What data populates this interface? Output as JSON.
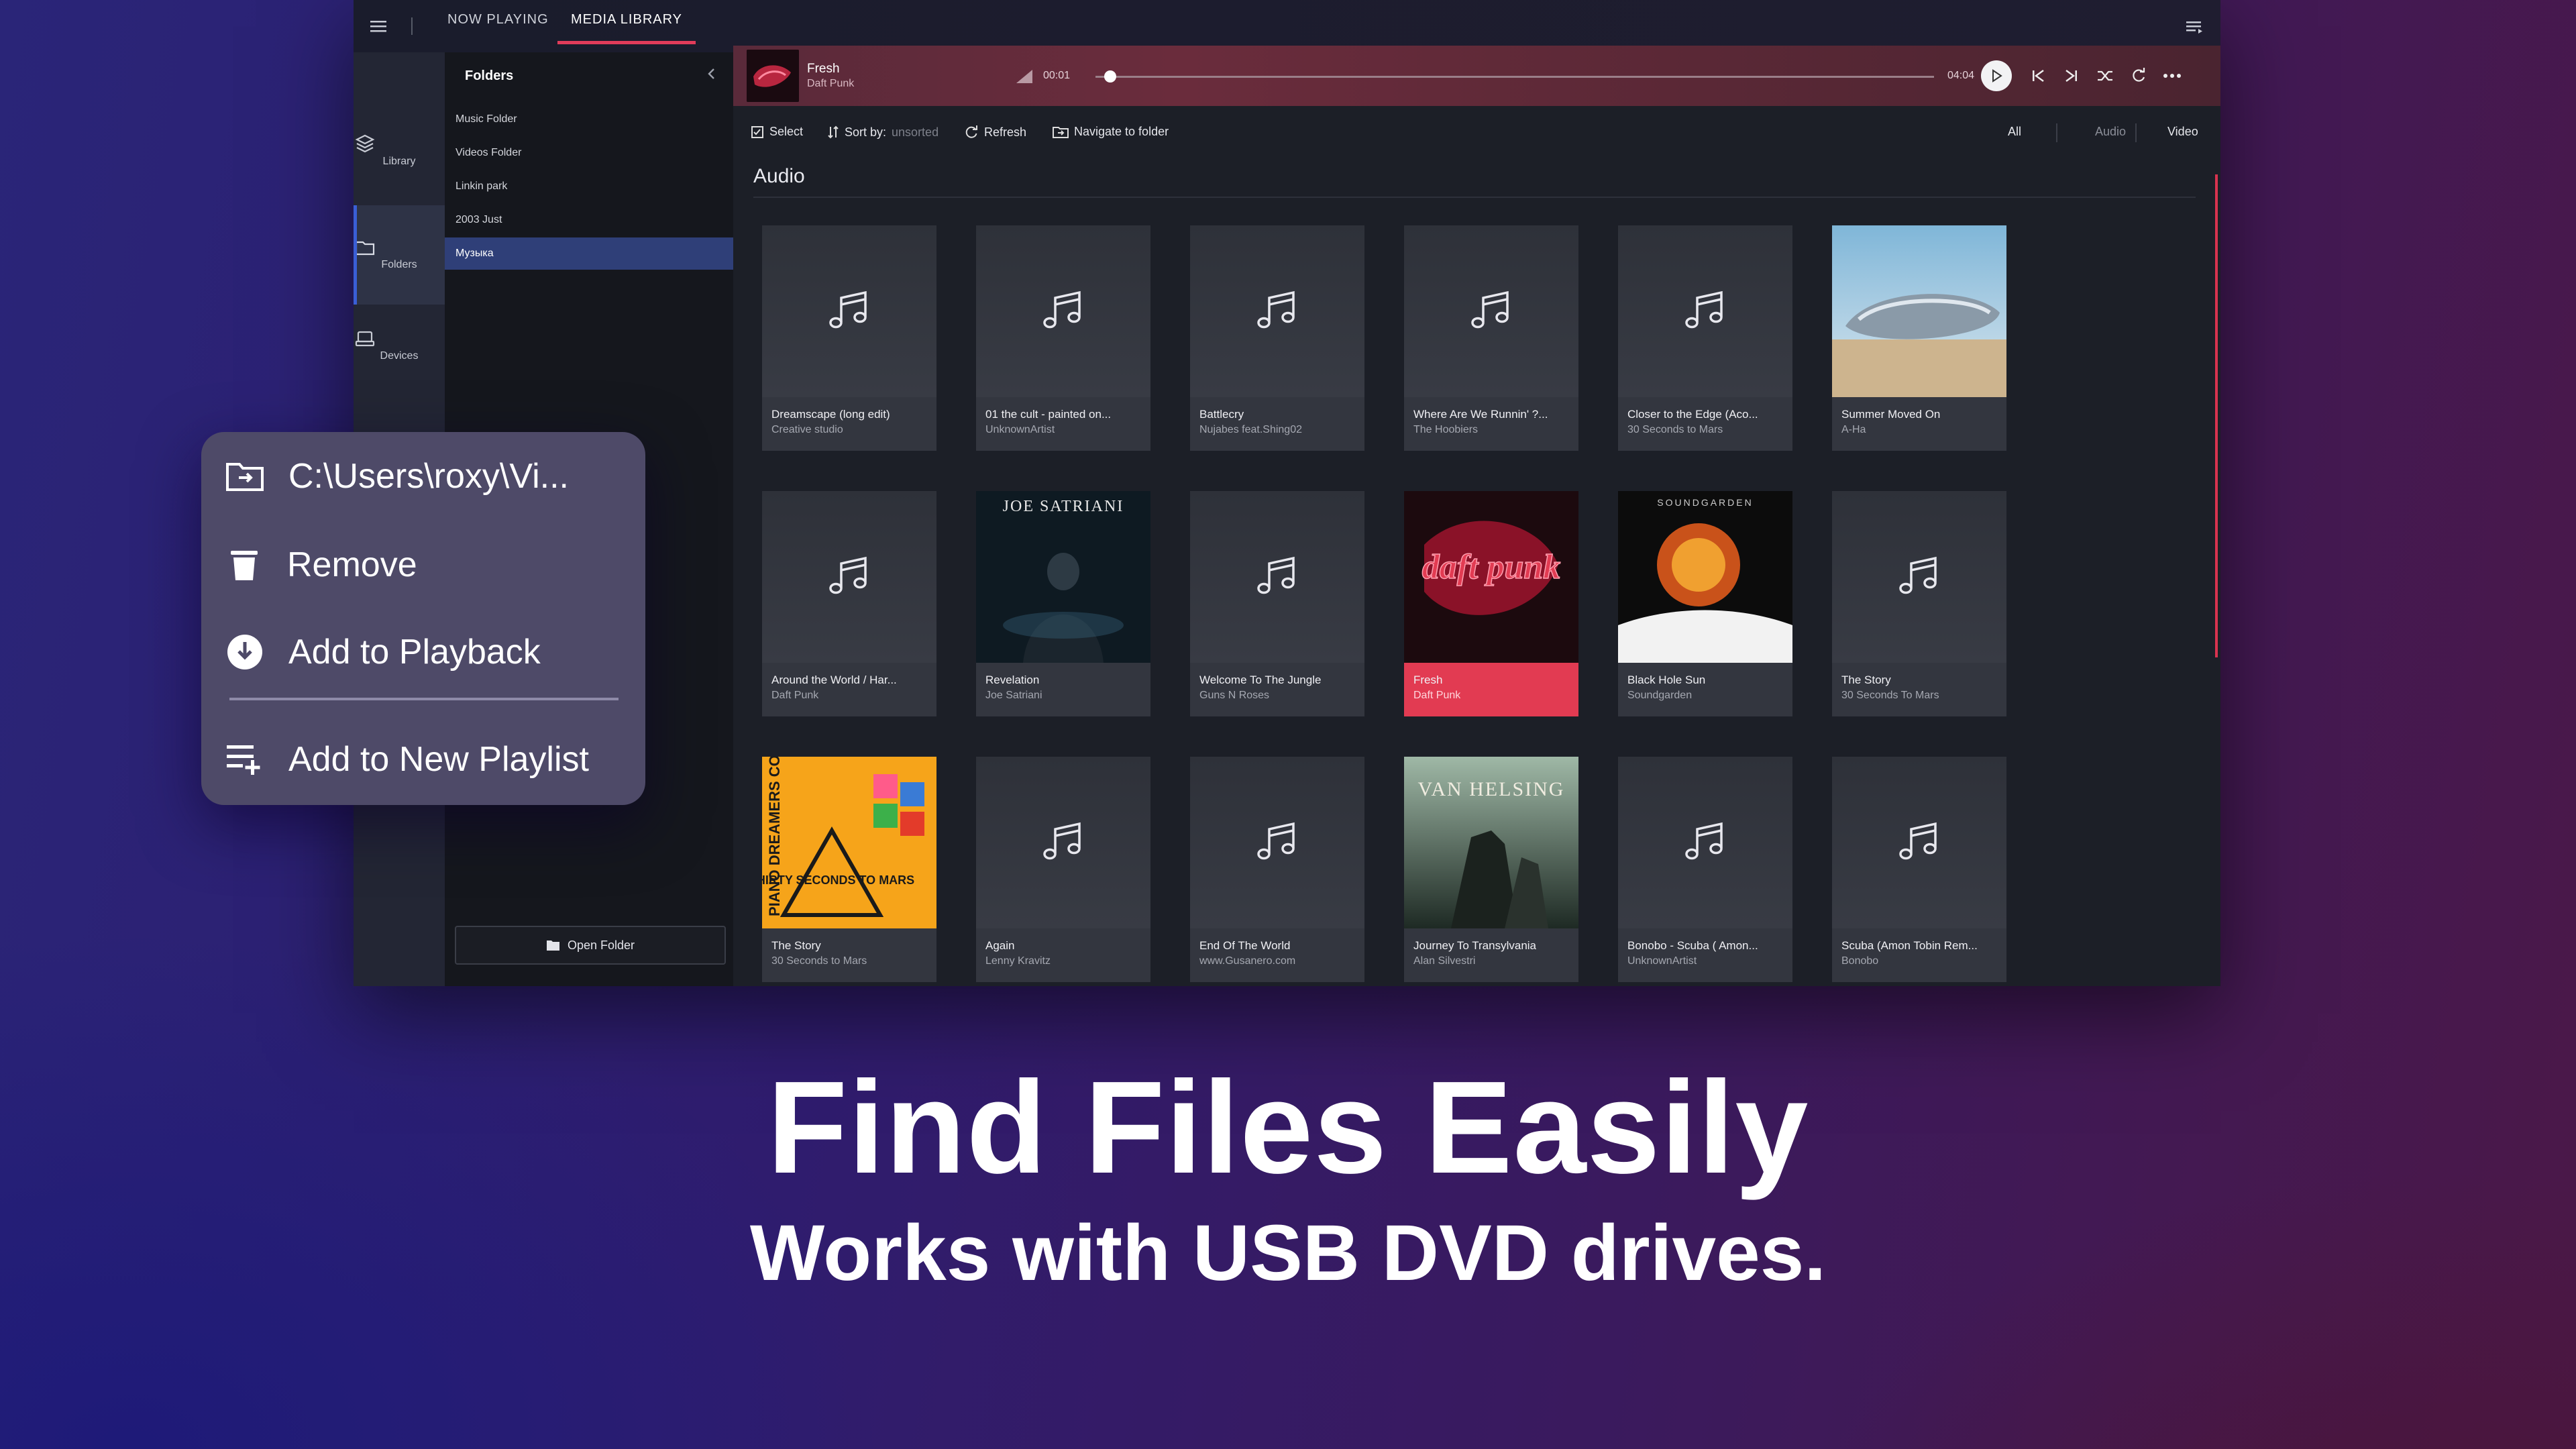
{
  "nav": {
    "now_playing": "NOW PLAYING",
    "media_library": "MEDIA LIBRARY"
  },
  "rail": [
    {
      "label": "Library",
      "icon": "library-icon"
    },
    {
      "label": "Folders",
      "icon": "folder-icon"
    },
    {
      "label": "Devices",
      "icon": "devices-icon"
    }
  ],
  "folders": {
    "title": "Folders",
    "items": [
      "Music Folder",
      "Videos Folder",
      "Linkin park",
      "2003 Just",
      "Музыка"
    ],
    "selected": "Музыка",
    "open_folder": "Open Folder"
  },
  "player": {
    "title": "Fresh",
    "artist": "Daft Punk",
    "current_time": "00:01",
    "total_time": "04:04",
    "progress": 0.01
  },
  "toolbar": {
    "select": "Select",
    "sort_by": "Sort by:",
    "sort_value": "unsorted",
    "refresh": "Refresh",
    "navigate": "Navigate to folder",
    "filter_all": "All",
    "filter_audio": "Audio",
    "filter_video": "Video"
  },
  "section_title": "Audio",
  "tiles": [
    {
      "title": "Dreamscape (long edit)",
      "artist": "Creative studio",
      "art": "note"
    },
    {
      "title": "01 the cult - painted on...",
      "artist": "UnknownArtist",
      "art": "note"
    },
    {
      "title": "Battlecry",
      "artist": "Nujabes feat.Shing02",
      "art": "note"
    },
    {
      "title": "Where Are We Runnin' ?...",
      "artist": "The Hoobiers",
      "art": "note"
    },
    {
      "title": "Closer to the Edge (Aco...",
      "artist": "30 Seconds to Mars",
      "art": "note"
    },
    {
      "title": "Summer Moved On",
      "artist": "A-Ha",
      "art": "aha"
    },
    {
      "title": "Around the World / Har...",
      "artist": "Daft Punk",
      "art": "note"
    },
    {
      "title": "Revelation",
      "artist": "Joe Satriani",
      "art": "satriani"
    },
    {
      "title": "Welcome To The Jungle",
      "artist": "Guns N Roses",
      "art": "note"
    },
    {
      "title": "Fresh",
      "artist": "Daft Punk",
      "art": "daftpunk",
      "playing": true
    },
    {
      "title": "Black Hole Sun",
      "artist": "Soundgarden",
      "art": "soundgarden"
    },
    {
      "title": "The Story",
      "artist": "30 Seconds To Mars",
      "art": "note"
    },
    {
      "title": "The Story",
      "artist": "30 Seconds to Mars",
      "art": "pianodreamers"
    },
    {
      "title": "Again",
      "artist": "Lenny Kravitz",
      "art": "note"
    },
    {
      "title": "End Of The World",
      "artist": "www.Gusanero.com",
      "art": "note"
    },
    {
      "title": "Journey To Transylvania",
      "artist": "Alan Silvestri",
      "art": "vanhelsing"
    },
    {
      "title": "Bonobo - Scuba ( Amon...",
      "artist": "UnknownArtist",
      "art": "note"
    },
    {
      "title": "Scuba (Amon Tobin Rem...",
      "artist": "Bonobo",
      "art": "note"
    }
  ],
  "art_text": {
    "satriani": "JOE SATRIANI",
    "daftpunk": "daft punk",
    "pianodreamers": "PIANO DREAMERS COVER",
    "thirty": "THIRTY SECONDS TO MARS",
    "vanhelsing": "VAN HELSING",
    "soundgarden": "SOUNDGARDEN"
  },
  "context_menu": {
    "path": "C:\\Users\\roxy\\Vi...",
    "remove": "Remove",
    "add_playback": "Add to Playback",
    "add_playlist": "Add to New Playlist"
  },
  "headline": {
    "title": "Find Files Easily",
    "subtitle": "Works with USB DVD drives."
  },
  "colors": {
    "accent": "#e23b52",
    "selection": "#2f3f78",
    "menu_bg": "#4e4a68"
  }
}
